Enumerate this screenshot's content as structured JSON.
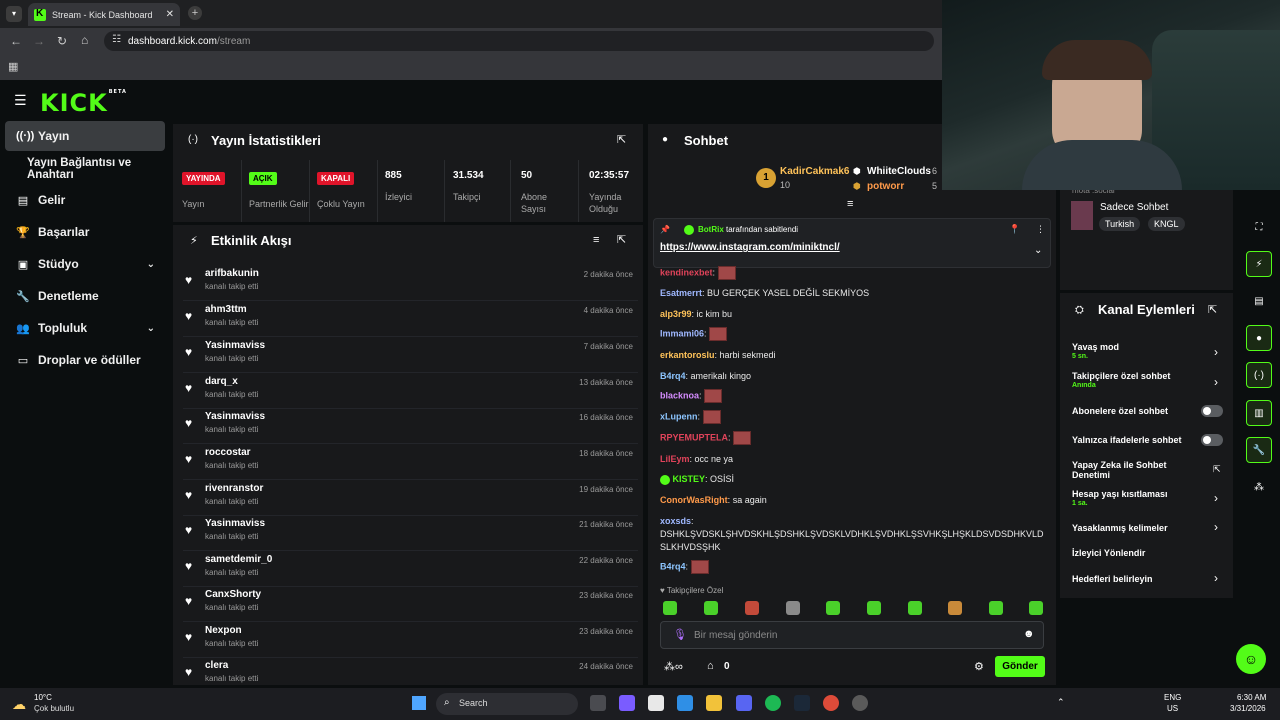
{
  "browser": {
    "tab_title": "Stream - Kick Dashboard",
    "url_domain": "dashboard.kick.com",
    "url_path": "/stream"
  },
  "brand": {
    "logo": "KICK",
    "logo_sup": "BETA",
    "accent": "#53fc18"
  },
  "nav": {
    "items": [
      {
        "label": "Yayın",
        "icon": "broadcast-icon"
      },
      {
        "label": "Yayın Bağlantısı ve Anahtarı",
        "icon": ""
      },
      {
        "label": "Gelir",
        "icon": "revenue-icon"
      },
      {
        "label": "Başarılar",
        "icon": "trophy-icon"
      },
      {
        "label": "Stüdyo",
        "icon": "studio-icon"
      },
      {
        "label": "Denetleme",
        "icon": "wrench-icon"
      },
      {
        "label": "Topluluk",
        "icon": "community-icon"
      },
      {
        "label": "Droplar ve ödüller",
        "icon": "drops-icon"
      }
    ]
  },
  "stats": {
    "title": "Yayın İstatistikleri",
    "items": [
      {
        "badge": "YAYINDA",
        "label": "Yayın"
      },
      {
        "badge": "AÇIK",
        "label": "Partnerlik Gelir"
      },
      {
        "badge": "KAPALI",
        "label": "Çoklu Yayın"
      },
      {
        "value": "885",
        "label": "İzleyici"
      },
      {
        "value": "31.534",
        "label": "Takipçi"
      },
      {
        "value": "50",
        "label": "Abone Sayısı"
      },
      {
        "value": "02:35:57",
        "label": "Yayında Olduğu Sü..."
      }
    ]
  },
  "activity": {
    "title": "Etkinlik Akışı",
    "action": "kanalı takip etti",
    "rows": [
      {
        "user": "arifbakunin",
        "time": "2 dakika önce"
      },
      {
        "user": "ahm3ttm",
        "time": "4 dakika önce"
      },
      {
        "user": "Yasinmaviss",
        "time": "7 dakika önce"
      },
      {
        "user": "darq_x",
        "time": "13 dakika önce"
      },
      {
        "user": "Yasinmaviss",
        "time": "16 dakika önce"
      },
      {
        "user": "roccostar",
        "time": "18 dakika önce"
      },
      {
        "user": "rivenranstor",
        "time": "19 dakika önce"
      },
      {
        "user": "Yasinmaviss",
        "time": "21 dakika önce"
      },
      {
        "user": "sametdemir_0",
        "time": "22 dakika önce"
      },
      {
        "user": "CanxShorty",
        "time": "23 dakika önce"
      },
      {
        "user": "Nexpon",
        "time": "23 dakika önce"
      },
      {
        "user": "clera",
        "time": "24 dakika önce"
      }
    ]
  },
  "chat": {
    "title": "Sohbet",
    "top_gifters": [
      {
        "name": "KadirCakmak6",
        "count": "10"
      },
      {
        "name": "WhiiteClouds",
        "count": "6"
      },
      {
        "name": "potworr",
        "count": "5"
      }
    ],
    "pinned": {
      "by": "BotRix",
      "by_suffix": "tarafından sabitlendi",
      "link": "https://www.instagram.com/miniktncl/"
    },
    "messages": [
      {
        "user": "kendinexbet",
        "text": "",
        "color": "#e0435a",
        "emote": true
      },
      {
        "user": "Esatmerrt",
        "text": "BU GERÇEK YASEL DEĞİL SEKMİYOS",
        "color": "#9fb8ff"
      },
      {
        "user": "alp3r99",
        "text": "ic kim bu",
        "color": "#ffc35a"
      },
      {
        "user": "Immami06",
        "text": "",
        "color": "#9fb8ff",
        "emote": true
      },
      {
        "user": "erkantoroslu",
        "text": "harbi sekmedi",
        "color": "#ffc35a"
      },
      {
        "user": "B4rq4",
        "text": "amerikalı kingo",
        "color": "#8cc5ff"
      },
      {
        "user": "blacknoa",
        "text": "",
        "color": "#d58cff",
        "emote": true
      },
      {
        "user": "xLupenn",
        "text": "",
        "color": "#8cc5ff",
        "emote": true
      },
      {
        "user": "RPYEMUPTELA",
        "text": "",
        "color": "#e0435a",
        "emote": true
      },
      {
        "user": "LilEym",
        "text": "occ ne ya",
        "color": "#e0435a"
      },
      {
        "user": "KISTEY",
        "text": "OSİSİ",
        "color": "#53fc18"
      },
      {
        "user": "ConorWasRight",
        "text": "sa again",
        "color": "#ff9a4a"
      },
      {
        "user": "xoxsds",
        "text": "DSHKLŞVDSKLŞHVDSKHLŞDSHKLŞVDSKLVDHKLŞVDHKLŞSVHKŞLHŞKLDSVDSDHKVLDSLKHVDSŞHK",
        "color": "#9fb8ff"
      },
      {
        "user": "B4rq4",
        "text": "",
        "color": "#8cc5ff",
        "emote": true
      }
    ],
    "followers_only": "Takipçilere Özel",
    "input_placeholder": "Bir mesaj gönderin",
    "points": "0",
    "send_label": "Gönder"
  },
  "channel_info": {
    "title_fragment": "mota .social",
    "chat_mode": "Sadece Sohbet",
    "tags": [
      "Turkish",
      "KNGL"
    ]
  },
  "channel_actions": {
    "title": "Kanal Eylemleri",
    "rows": [
      {
        "label": "Yavaş mod",
        "sub": "5 sn.",
        "type": "arrow"
      },
      {
        "label": "Takipçilere özel sohbet",
        "sub": "Anında",
        "type": "arrow"
      },
      {
        "label": "Abonelere özel sohbet",
        "sub": "",
        "type": "toggle"
      },
      {
        "label": "Yalnızca ifadelerle sohbet",
        "sub": "",
        "type": "toggle"
      },
      {
        "label": "Yapay Zeka ile Sohbet Denetimi",
        "sub": "",
        "type": "external"
      },
      {
        "label": "Hesap yaşı kısıtlaması",
        "sub": "1 sa.",
        "type": "arrow"
      },
      {
        "label": "Yasaklanmış kelimeler",
        "sub": "",
        "type": "arrow"
      },
      {
        "label": "İzleyici Yönlendir",
        "sub": "",
        "type": "none"
      },
      {
        "label": "Hedefleri belirleyin",
        "sub": "",
        "type": "arrow"
      }
    ]
  },
  "taskbar": {
    "weather_temp": "10°C",
    "weather_desc": "Çok bulutlu",
    "search": "Search",
    "lang": "ENG",
    "region": "US",
    "time": "6:30 AM",
    "date": "3/31/2026"
  }
}
